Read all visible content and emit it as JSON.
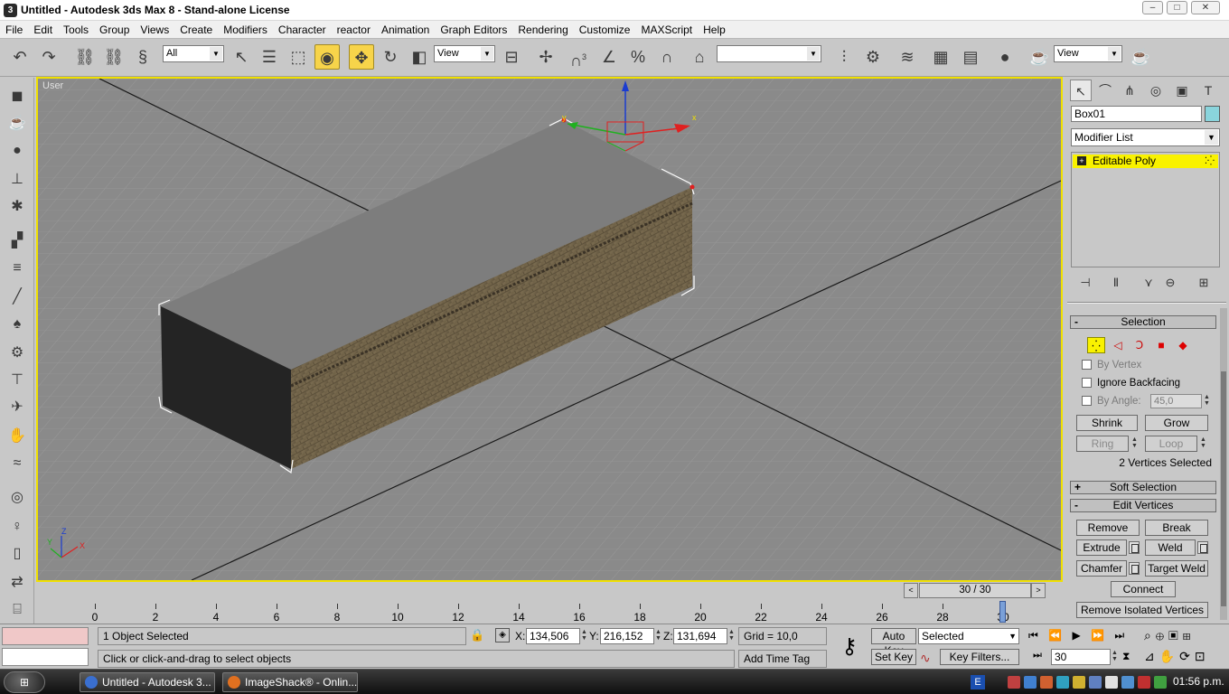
{
  "window": {
    "title": "Untitled - Autodesk 3ds Max 8 - Stand-alone License",
    "app_icon_glyph": "3"
  },
  "menu": [
    "File",
    "Edit",
    "Tools",
    "Group",
    "Views",
    "Create",
    "Modifiers",
    "Character",
    "reactor",
    "Animation",
    "Graph Editors",
    "Rendering",
    "Customize",
    "MAXScript",
    "Help"
  ],
  "toolbar": {
    "selection_filter": "All",
    "ref_coord_1": "View",
    "named_selection": "",
    "ref_coord_2": "View",
    "snap_angle_label": "3",
    "percent_label": "%"
  },
  "viewport": {
    "label": "User",
    "axis_x": "X",
    "axis_y": "Y",
    "axis_z": "Z",
    "gizmo_x": "x",
    "gizmo_y": "y",
    "gizmo_z": "z",
    "border_color": "#f0e000",
    "bg_color": "#8a8a8a"
  },
  "command_panel": {
    "object_name": "Box01",
    "object_color": "#8ad4dc",
    "modifier_list": "Modifier List",
    "stack_item": "Editable Poly",
    "selection": {
      "title": "Selection",
      "by_vertex": "By Vertex",
      "ignore_backfacing": "Ignore Backfacing",
      "by_angle": "By Angle:",
      "by_angle_value": "45,0",
      "shrink": "Shrink",
      "grow": "Grow",
      "ring": "Ring",
      "loop": "Loop",
      "status": "2 Vertices Selected"
    },
    "soft_selection": "Soft Selection",
    "edit_vertices": {
      "title": "Edit Vertices",
      "remove": "Remove",
      "break": "Break",
      "extrude": "Extrude",
      "weld": "Weld",
      "chamfer": "Chamfer",
      "target_weld": "Target Weld",
      "connect": "Connect",
      "remove_isolated": "Remove Isolated Vertices"
    }
  },
  "timeslider": {
    "label": "30 / 30",
    "prev": "<",
    "next": ">"
  },
  "trackbar": {
    "ticks": [
      "0",
      "2",
      "4",
      "6",
      "8",
      "10",
      "12",
      "14",
      "16",
      "18",
      "20",
      "22",
      "24",
      "26",
      "28",
      "30"
    ],
    "current_frame": 30
  },
  "status": {
    "selection_count": "1 Object Selected",
    "prompt": "Click or click-and-drag to select objects",
    "x_label": "X:",
    "x_value": "134,506",
    "y_label": "Y:",
    "y_value": "216,152",
    "z_label": "Z:",
    "z_value": "131,694",
    "grid": "Grid = 10,0",
    "add_time_tag": "Add Time Tag",
    "auto_key": "Auto Key",
    "set_key": "Set Key",
    "key_mode": "Selected",
    "key_filters": "Key Filters...",
    "frame": "30"
  },
  "taskbar": {
    "items": [
      {
        "label": "Untitled - Autodesk 3...",
        "color": "#3a6fd0"
      },
      {
        "label": "ImageShack® - Onlin...",
        "color": "#e07020"
      }
    ],
    "lang": "E",
    "clock": "01:56 p.m."
  }
}
